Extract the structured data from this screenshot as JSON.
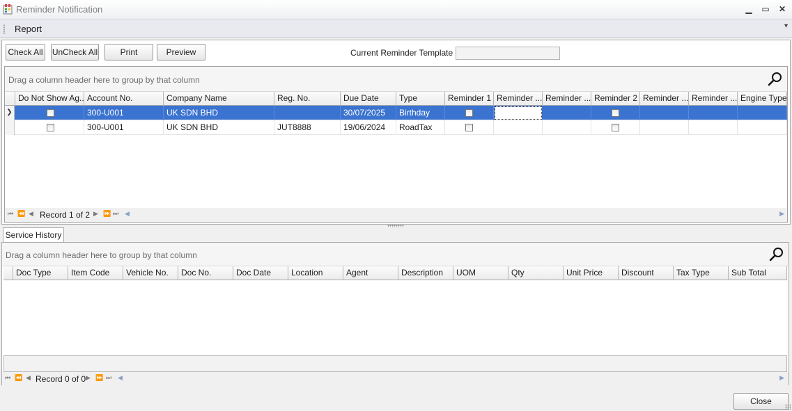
{
  "window": {
    "title": "Reminder Notification",
    "minimize_glyph": "▁",
    "maximize_glyph": "▭",
    "close_glyph": "✕"
  },
  "menubar": {
    "items": [
      "Report"
    ],
    "overflow_glyph": "▾"
  },
  "toolbar": {
    "check_all": "Check All",
    "uncheck_all": "UnCheck All",
    "print": "Print",
    "preview": "Preview",
    "template_label": "Current Reminder Template :",
    "template_value": ""
  },
  "reminder_grid": {
    "group_hint": "Drag a column header here to group by that column",
    "columns": [
      "Do Not Show Ag...",
      "Account No.",
      "Company Name",
      "Reg. No.",
      "Due Date",
      "Type",
      "Reminder 1",
      "Reminder ...",
      "Reminder ...",
      "Reminder 2",
      "Reminder ...",
      "Reminder ...",
      "Engine Type"
    ],
    "rows": [
      {
        "do_not_show": false,
        "account_no": "300-U001",
        "company_name": "UK SDN BHD",
        "reg_no": "",
        "due_date": "30/07/2025",
        "type": "Birthday",
        "reminder_1": false,
        "reminder_2": false,
        "selected": true
      },
      {
        "do_not_show": false,
        "account_no": "300-U001",
        "company_name": "UK SDN BHD",
        "reg_no": "JUT8888",
        "due_date": "19/06/2024",
        "type": "RoadTax",
        "reminder_1": false,
        "reminder_2": false,
        "selected": false
      }
    ],
    "record_text": "Record 1 of 2"
  },
  "tabs": [
    "Service History"
  ],
  "history_grid": {
    "group_hint": "Drag a column header here to group by that column",
    "columns": [
      "Doc Type",
      "Item Code",
      "Vehicle No.",
      "Doc No.",
      "Doc Date",
      "Location",
      "Agent",
      "Description",
      "UOM",
      "Qty",
      "Unit Price",
      "Discount",
      "Tax Type",
      "Sub Total"
    ],
    "record_text": "Record 0 of 0"
  },
  "footer": {
    "close": "Close"
  },
  "colors": {
    "selection": "#3a73d0",
    "window_bg": "#f0f0f0"
  }
}
